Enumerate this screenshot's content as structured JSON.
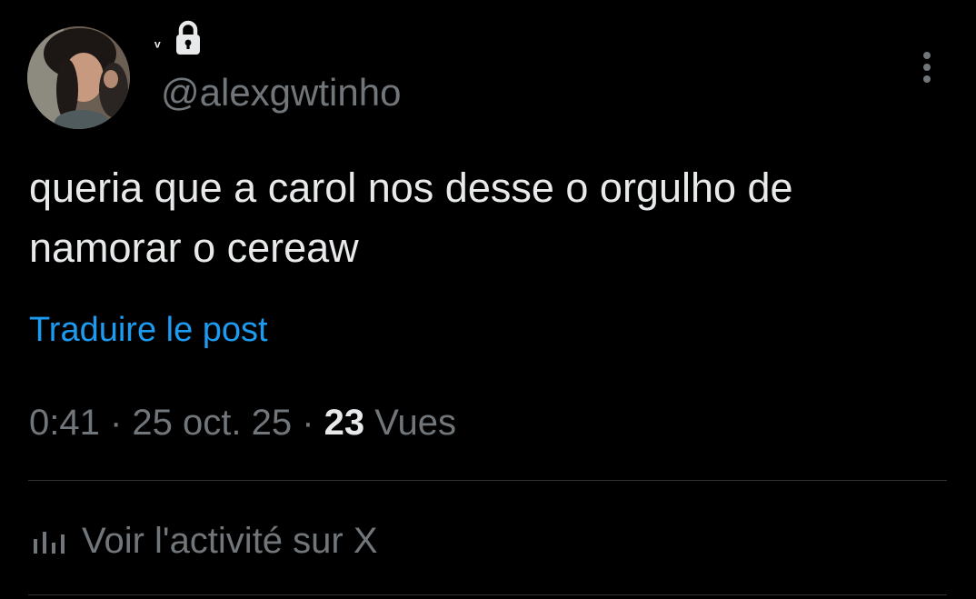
{
  "user": {
    "display_name": "ᵛ",
    "handle": "@alexgwtinho",
    "protected": true
  },
  "post": {
    "text": "queria que a carol nos desse o orgulho de namorar o cereaw",
    "translate_label": "Traduire le post",
    "time": "0:41",
    "separator": " · ",
    "date": "25 oct. 25",
    "views_count": "23",
    "views_label": " Vues"
  },
  "activity": {
    "label": "Voir l'activité sur X"
  },
  "icons": {
    "lock": "lock-icon",
    "more": "more-vertical-icon",
    "activity": "bar-chart-icon"
  },
  "colors": {
    "background": "#000000",
    "text": "#e7e9ea",
    "secondary": "#71767b",
    "accent": "#1d9bf0",
    "divider": "#2f3336"
  }
}
